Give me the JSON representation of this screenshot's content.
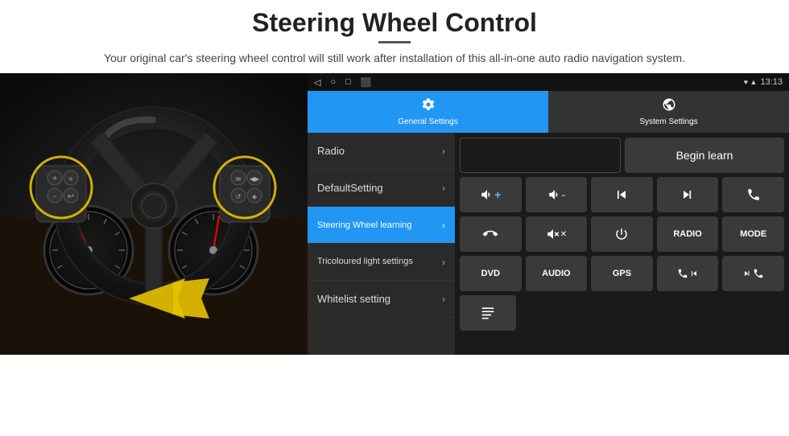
{
  "header": {
    "title": "Steering Wheel Control",
    "divider": true,
    "subtitle": "Your original car's steering wheel control will still work after installation of this all-in-one auto radio navigation system."
  },
  "status_bar": {
    "nav_icons": [
      "◁",
      "○",
      "□",
      "⬛"
    ],
    "right_icons": "♥ ▲",
    "time": "13:13"
  },
  "tabs": [
    {
      "id": "general",
      "icon": "⚙",
      "label": "General Settings",
      "active": true
    },
    {
      "id": "system",
      "icon": "⚙",
      "label": "System Settings",
      "active": false
    }
  ],
  "menu_items": [
    {
      "id": "radio",
      "label": "Radio",
      "active": false
    },
    {
      "id": "default_setting",
      "label": "DefaultSetting",
      "active": false
    },
    {
      "id": "steering_wheel",
      "label": "Steering Wheel learning",
      "active": true
    },
    {
      "id": "tricoloured",
      "label": "Tricoloured light settings",
      "active": false
    },
    {
      "id": "whitelist",
      "label": "Whitelist setting",
      "active": false
    }
  ],
  "controls": {
    "begin_learn_label": "Begin learn",
    "rows": [
      {
        "type": "begin_learn_row",
        "empty": true,
        "begin_learn": "Begin learn"
      },
      {
        "type": "icon_row",
        "buttons": [
          {
            "id": "vol_up",
            "icon": "🔊+",
            "text": "🔊+"
          },
          {
            "id": "vol_down",
            "icon": "🔊-",
            "text": "🔊-"
          },
          {
            "id": "prev_track",
            "icon": "⏮",
            "text": "⏮"
          },
          {
            "id": "next_track",
            "icon": "⏭",
            "text": "⏭"
          },
          {
            "id": "phone",
            "icon": "📞",
            "text": "✆"
          }
        ]
      },
      {
        "type": "icon_row",
        "buttons": [
          {
            "id": "hang_up",
            "icon": "↩",
            "text": "↩"
          },
          {
            "id": "mute",
            "icon": "🔇",
            "text": "🔊✕"
          },
          {
            "id": "power",
            "icon": "⏻",
            "text": "⏻"
          },
          {
            "id": "radio_btn",
            "icon": "RADIO",
            "text": "RADIO"
          },
          {
            "id": "mode_btn",
            "icon": "MODE",
            "text": "MODE"
          }
        ]
      },
      {
        "type": "icon_row",
        "buttons": [
          {
            "id": "dvd_btn",
            "icon": "DVD",
            "text": "DVD"
          },
          {
            "id": "audio_btn",
            "icon": "AUDIO",
            "text": "AUDIO"
          },
          {
            "id": "gps_btn",
            "icon": "GPS",
            "text": "GPS"
          },
          {
            "id": "call_prev",
            "icon": "📞⏮",
            "text": "✆⏮"
          },
          {
            "id": "call_next",
            "icon": "📞⏭",
            "text": "✆⏭"
          }
        ]
      },
      {
        "type": "icon_row",
        "buttons": [
          {
            "id": "list_btn",
            "icon": "☰",
            "text": "☰"
          }
        ]
      }
    ]
  }
}
